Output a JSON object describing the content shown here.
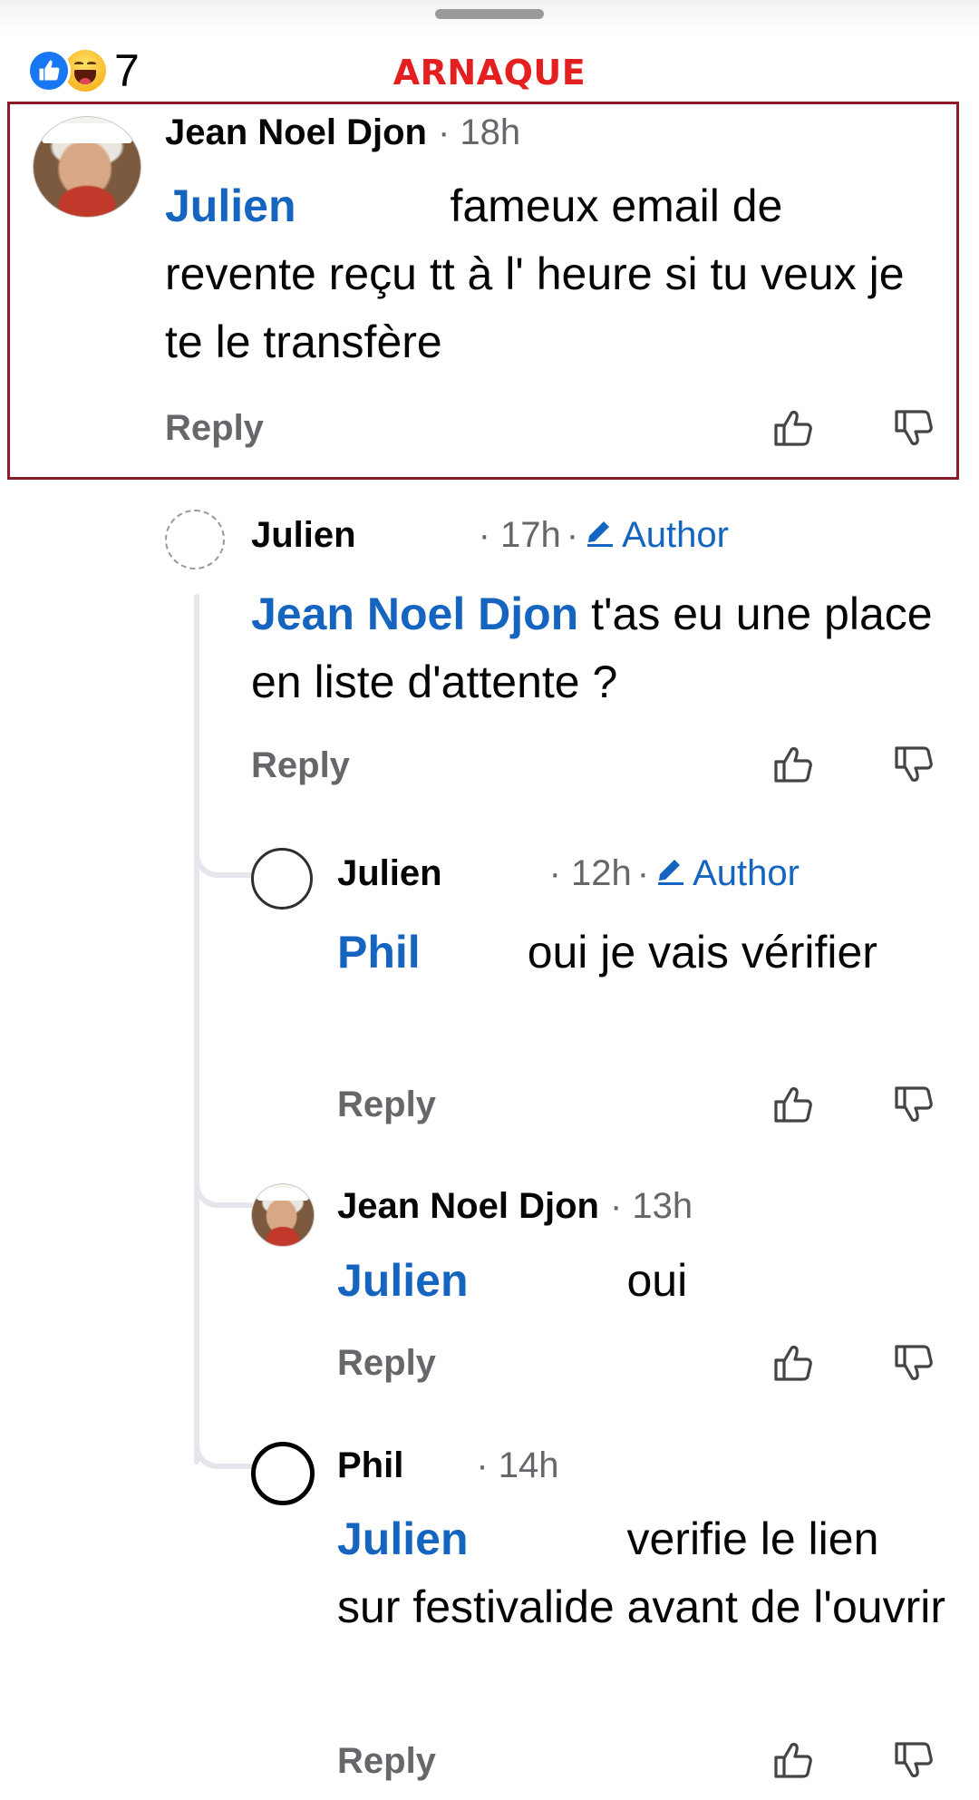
{
  "header": {
    "reaction_count": "7",
    "annotation_label": "ARNAQUE",
    "reaction_icons": [
      "like-reaction-icon",
      "haha-reaction-icon"
    ]
  },
  "comments": [
    {
      "author": "Jean Noel Djon",
      "time": "· 18h",
      "mention": "Julien",
      "text_line1": "fameux email de",
      "text_rest": "revente reçu tt à l' heure si tu veux je te le transfère",
      "reply_label": "Reply"
    },
    {
      "author": "Julien",
      "time": "· 17h",
      "badge": "Author",
      "mention": "Jean Noel Djon",
      "text": " t'as eu une place en liste d'attente ?",
      "reply_label": "Reply"
    },
    {
      "author": "Julien",
      "time": "· 12h",
      "badge": "Author",
      "mention": "Phil",
      "text": "oui je vais vérifier",
      "reply_label": "Reply"
    },
    {
      "author": "Jean Noel Djon",
      "time": "· 13h",
      "mention": "Julien",
      "text": "oui",
      "reply_label": "Reply"
    },
    {
      "author": "Phil",
      "time": "· 14h",
      "mention": "Julien",
      "text_line1": "verifie le lien",
      "text_rest": "sur festivalide avant de l'ouvrir",
      "reply_label": "Reply"
    }
  ],
  "colors": {
    "mention_blue": "#1464c0",
    "annotation_red": "#e3201f",
    "highlight_border": "#8b1a2a",
    "secondary_text": "#65676b",
    "thread_line": "#e4e6eb"
  },
  "icons": {
    "upvote": "thumbs-up-outline-icon",
    "downvote": "thumbs-down-outline-icon",
    "author_badge": "pencil-icon"
  }
}
